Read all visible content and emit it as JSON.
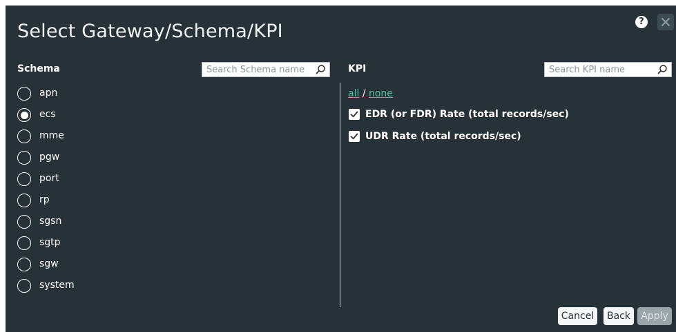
{
  "dialog": {
    "title": "Select Gateway/Schema/KPI",
    "help_label": "?"
  },
  "schema": {
    "heading": "Schema",
    "search_placeholder": "Search Schema name",
    "selected": "ecs",
    "items": [
      {
        "label": "apn",
        "selected": false
      },
      {
        "label": "ecs",
        "selected": true
      },
      {
        "label": "mme",
        "selected": false
      },
      {
        "label": "pgw",
        "selected": false
      },
      {
        "label": "port",
        "selected": false
      },
      {
        "label": "rp",
        "selected": false
      },
      {
        "label": "sgsn",
        "selected": false
      },
      {
        "label": "sgtp",
        "selected": false
      },
      {
        "label": "sgw",
        "selected": false
      },
      {
        "label": "system",
        "selected": false
      }
    ]
  },
  "kpi": {
    "heading": "KPI",
    "search_placeholder": "Search KPI name",
    "all_label": "all",
    "separator": "/",
    "none_label": "none",
    "items": [
      {
        "label": "EDR (or FDR) Rate (total records/sec)",
        "checked": true
      },
      {
        "label": "UDR Rate (total records/sec)",
        "checked": true
      }
    ]
  },
  "buttons": {
    "cancel": "Cancel",
    "back": "Back",
    "apply": "Apply"
  },
  "colors": {
    "background": "#263238",
    "link": "#4fc3a1",
    "apply_disabled": "#9aa4a9"
  },
  "icons": {
    "help": "question-circle-icon",
    "close": "close-icon",
    "search": "magnifier-icon",
    "check": "checkmark-icon"
  }
}
